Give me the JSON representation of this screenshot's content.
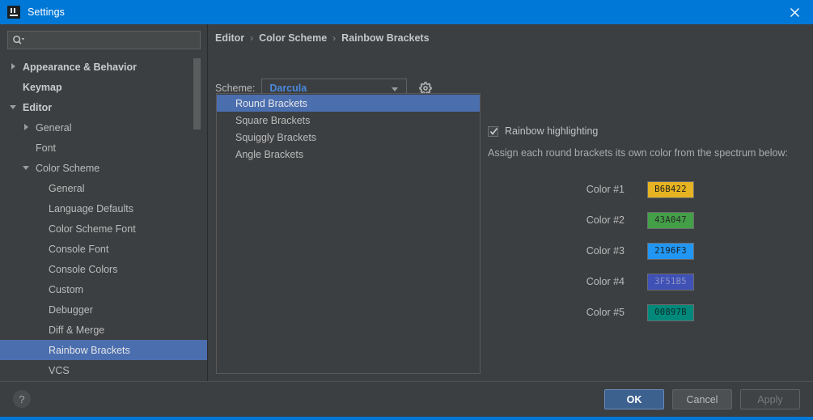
{
  "window": {
    "title": "Settings",
    "app_icon": "intellij-idea-icon",
    "close_icon": "close-icon",
    "titlebar_color": "#0078d7"
  },
  "search": {
    "value": "",
    "placeholder": "",
    "icon": "search-icon"
  },
  "sidebar": {
    "items": [
      {
        "label": "Appearance & Behavior",
        "indent": 0,
        "arrow": "right",
        "bold": true,
        "selected": false
      },
      {
        "label": "Keymap",
        "indent": 0,
        "arrow": "none",
        "bold": true,
        "selected": false
      },
      {
        "label": "Editor",
        "indent": 0,
        "arrow": "down",
        "bold": true,
        "selected": false
      },
      {
        "label": "General",
        "indent": 1,
        "arrow": "right",
        "bold": false,
        "selected": false
      },
      {
        "label": "Font",
        "indent": 1,
        "arrow": "none",
        "bold": false,
        "selected": false
      },
      {
        "label": "Color Scheme",
        "indent": 1,
        "arrow": "down",
        "bold": false,
        "selected": false
      },
      {
        "label": "General",
        "indent": 2,
        "arrow": "none",
        "bold": false,
        "selected": false
      },
      {
        "label": "Language Defaults",
        "indent": 2,
        "arrow": "none",
        "bold": false,
        "selected": false
      },
      {
        "label": "Color Scheme Font",
        "indent": 2,
        "arrow": "none",
        "bold": false,
        "selected": false
      },
      {
        "label": "Console Font",
        "indent": 2,
        "arrow": "none",
        "bold": false,
        "selected": false
      },
      {
        "label": "Console Colors",
        "indent": 2,
        "arrow": "none",
        "bold": false,
        "selected": false
      },
      {
        "label": "Custom",
        "indent": 2,
        "arrow": "none",
        "bold": false,
        "selected": false
      },
      {
        "label": "Debugger",
        "indent": 2,
        "arrow": "none",
        "bold": false,
        "selected": false
      },
      {
        "label": "Diff & Merge",
        "indent": 2,
        "arrow": "none",
        "bold": false,
        "selected": false
      },
      {
        "label": "Rainbow Brackets",
        "indent": 2,
        "arrow": "none",
        "bold": false,
        "selected": true
      },
      {
        "label": "VCS",
        "indent": 2,
        "arrow": "none",
        "bold": false,
        "selected": false
      }
    ],
    "selection_color": "#4b6eaf"
  },
  "breadcrumb": {
    "items": [
      "Editor",
      "Color Scheme",
      "Rainbow Brackets"
    ],
    "separator": "›"
  },
  "scheme": {
    "label": "Scheme:",
    "value": "Darcula",
    "value_color": "#4a88dd",
    "dropdown_icon": "chevron-down-icon",
    "gear_icon": "gear-icon"
  },
  "bracket_list": {
    "items": [
      {
        "label": "Round Brackets",
        "selected": true
      },
      {
        "label": "Square Brackets",
        "selected": false
      },
      {
        "label": "Squiggly Brackets",
        "selected": false
      },
      {
        "label": "Angle Brackets",
        "selected": false
      }
    ]
  },
  "options": {
    "rainbow_checkbox": {
      "label": "Rainbow highlighting",
      "checked": true
    },
    "hint": "Assign each round brackets its own color from the spectrum below:",
    "colors": [
      {
        "label": "Color #1",
        "hex": "B6B422",
        "swatch": "#e6b422",
        "text_color": "#1d1d1d"
      },
      {
        "label": "Color #2",
        "hex": "43A047",
        "swatch": "#43a047",
        "text_color": "#2a2a2a"
      },
      {
        "label": "Color #3",
        "hex": "2196F3",
        "swatch": "#2196f3",
        "text_color": "#1f1f1f"
      },
      {
        "label": "Color #4",
        "hex": "3F51B5",
        "swatch": "#3f51b5",
        "text_color": "#8f95c6"
      },
      {
        "label": "Color #5",
        "hex": "00897B",
        "swatch": "#00897b",
        "text_color": "#0e2b28"
      }
    ]
  },
  "footer": {
    "help_label": "?",
    "ok_label": "OK",
    "cancel_label": "Cancel",
    "apply_label": "Apply"
  }
}
